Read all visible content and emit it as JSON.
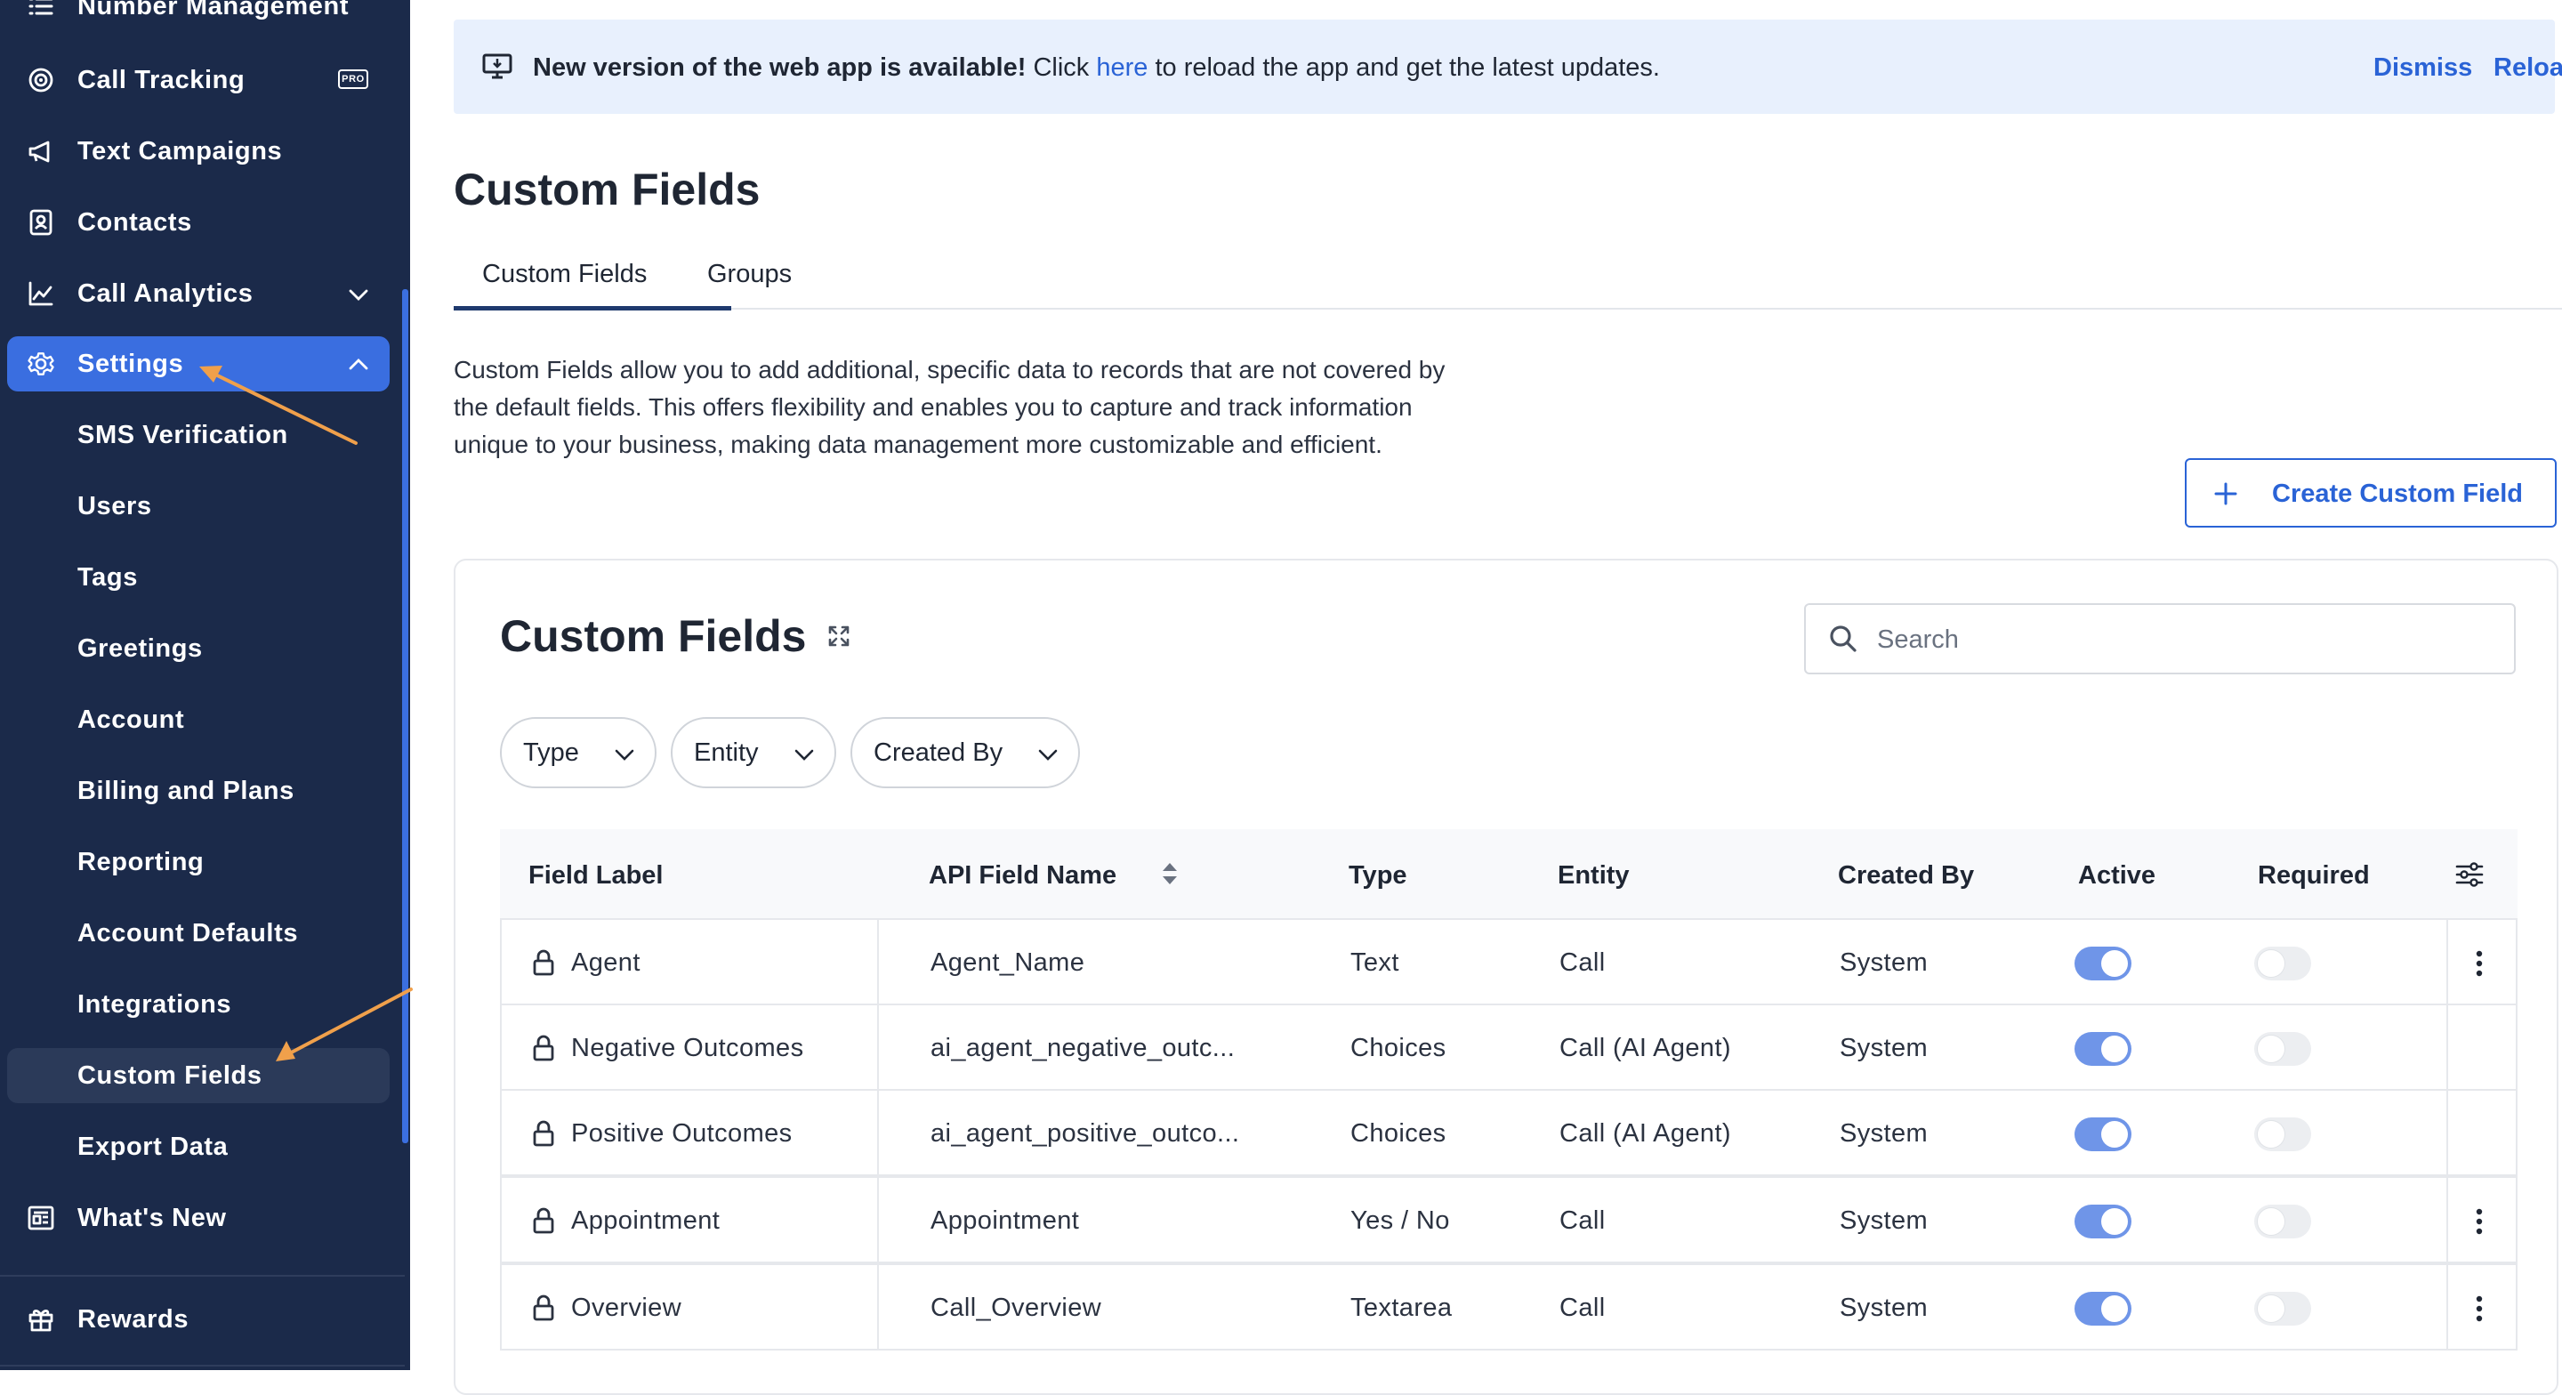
{
  "sidebar": {
    "items": [
      {
        "label": "Number Management",
        "icon": "list-icon"
      },
      {
        "label": "Call Tracking",
        "icon": "target-icon",
        "badge": "PRO"
      },
      {
        "label": "Text Campaigns",
        "icon": "megaphone-icon"
      },
      {
        "label": "Contacts",
        "icon": "contact-card-icon"
      },
      {
        "label": "Call Analytics",
        "icon": "line-chart-icon"
      },
      {
        "label": "Settings",
        "icon": "gear-icon"
      },
      {
        "label": "What's New",
        "icon": "news-icon"
      },
      {
        "label": "Rewards",
        "icon": "gift-icon"
      }
    ],
    "settings_sub": [
      "SMS Verification",
      "Users",
      "Tags",
      "Greetings",
      "Account",
      "Billing and Plans",
      "Reporting",
      "Account Defaults",
      "Integrations",
      "Custom Fields",
      "Export Data"
    ]
  },
  "banner": {
    "bold_text": "New version of the web app is available!",
    "text_before_link": " Click ",
    "link_text": "here",
    "text_after_link": " to reload the app and get the latest updates.",
    "dismiss": "Dismiss",
    "reload": "Reload"
  },
  "page": {
    "title": "Custom Fields",
    "tabs": [
      "Custom Fields",
      "Groups"
    ],
    "description": "Custom Fields allow you to add additional, specific data to records that are not covered by the default fields. This offers flexibility and enables you to capture and track information unique to your business, making data management more customizable and efficient.",
    "create_button": "Create Custom Field"
  },
  "card": {
    "title": "Custom Fields",
    "search_placeholder": "Search",
    "filters": [
      "Type",
      "Entity",
      "Created By"
    ],
    "columns": [
      "Field Label",
      "API Field Name",
      "Type",
      "Entity",
      "Created By",
      "Active",
      "Required"
    ],
    "rows": [
      {
        "label": "Agent",
        "api": "Agent_Name",
        "type": "Text",
        "entity": "Call",
        "created_by": "System",
        "active": true,
        "required": false,
        "menu": true
      },
      {
        "label": "Negative Outcomes",
        "api": "ai_agent_negative_outc...",
        "type": "Choices",
        "entity": "Call (AI Agent)",
        "created_by": "System",
        "active": true,
        "required": false,
        "menu": false
      },
      {
        "label": "Positive Outcomes",
        "api": "ai_agent_positive_outco...",
        "type": "Choices",
        "entity": "Call (AI Agent)",
        "created_by": "System",
        "active": true,
        "required": false,
        "menu": false
      },
      {
        "label": "Appointment",
        "api": "Appointment",
        "type": "Yes / No",
        "entity": "Call",
        "created_by": "System",
        "active": true,
        "required": false,
        "menu": true
      },
      {
        "label": "Overview",
        "api": "Call_Overview",
        "type": "Textarea",
        "entity": "Call",
        "created_by": "System",
        "active": true,
        "required": false,
        "menu": true
      }
    ]
  },
  "colors": {
    "sidebar_bg": "#1b2a4a",
    "accent": "#3a6ee0",
    "link": "#2a63d6",
    "annotation_arrow": "#f0a04b"
  }
}
